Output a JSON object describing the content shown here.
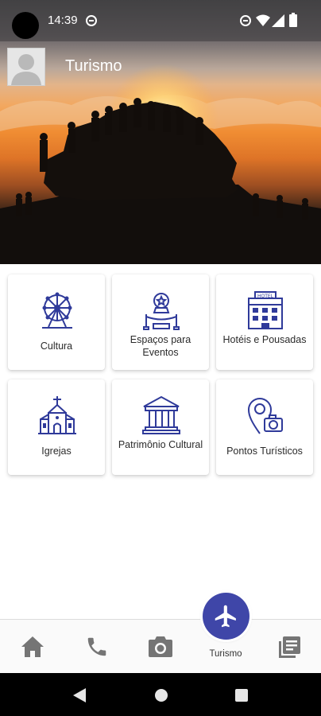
{
  "status_bar": {
    "time": "14:39",
    "icons": [
      "dnd-icon",
      "dnd-icon",
      "wifi-icon",
      "signal-icon",
      "battery-icon"
    ]
  },
  "header": {
    "title": "Turismo",
    "avatar_icon": "user-placeholder-icon"
  },
  "categories": [
    {
      "label": "Cultura",
      "icon": "ferris-wheel-icon"
    },
    {
      "label": "Espaços para Eventos",
      "icon": "event-space-icon"
    },
    {
      "label": "Hotéis e Pousadas",
      "icon": "hotel-icon"
    },
    {
      "label": "Igrejas",
      "icon": "church-icon"
    },
    {
      "label": "Patrimônio Cultural",
      "icon": "museum-icon"
    },
    {
      "label": "Pontos Turísticos",
      "icon": "location-camera-icon"
    }
  ],
  "bottom_nav": {
    "items": [
      {
        "name": "home",
        "icon": "home-icon"
      },
      {
        "name": "phone",
        "icon": "phone-icon"
      },
      {
        "name": "camera",
        "icon": "camera-icon"
      },
      {
        "name": "turismo",
        "icon": "airplane-icon",
        "label": "Turismo",
        "active": true
      },
      {
        "name": "news",
        "icon": "news-icon"
      }
    ]
  },
  "colors": {
    "accent": "#3f46a8",
    "icon_line": "#2f3a9a",
    "nav_icon": "#757575"
  }
}
